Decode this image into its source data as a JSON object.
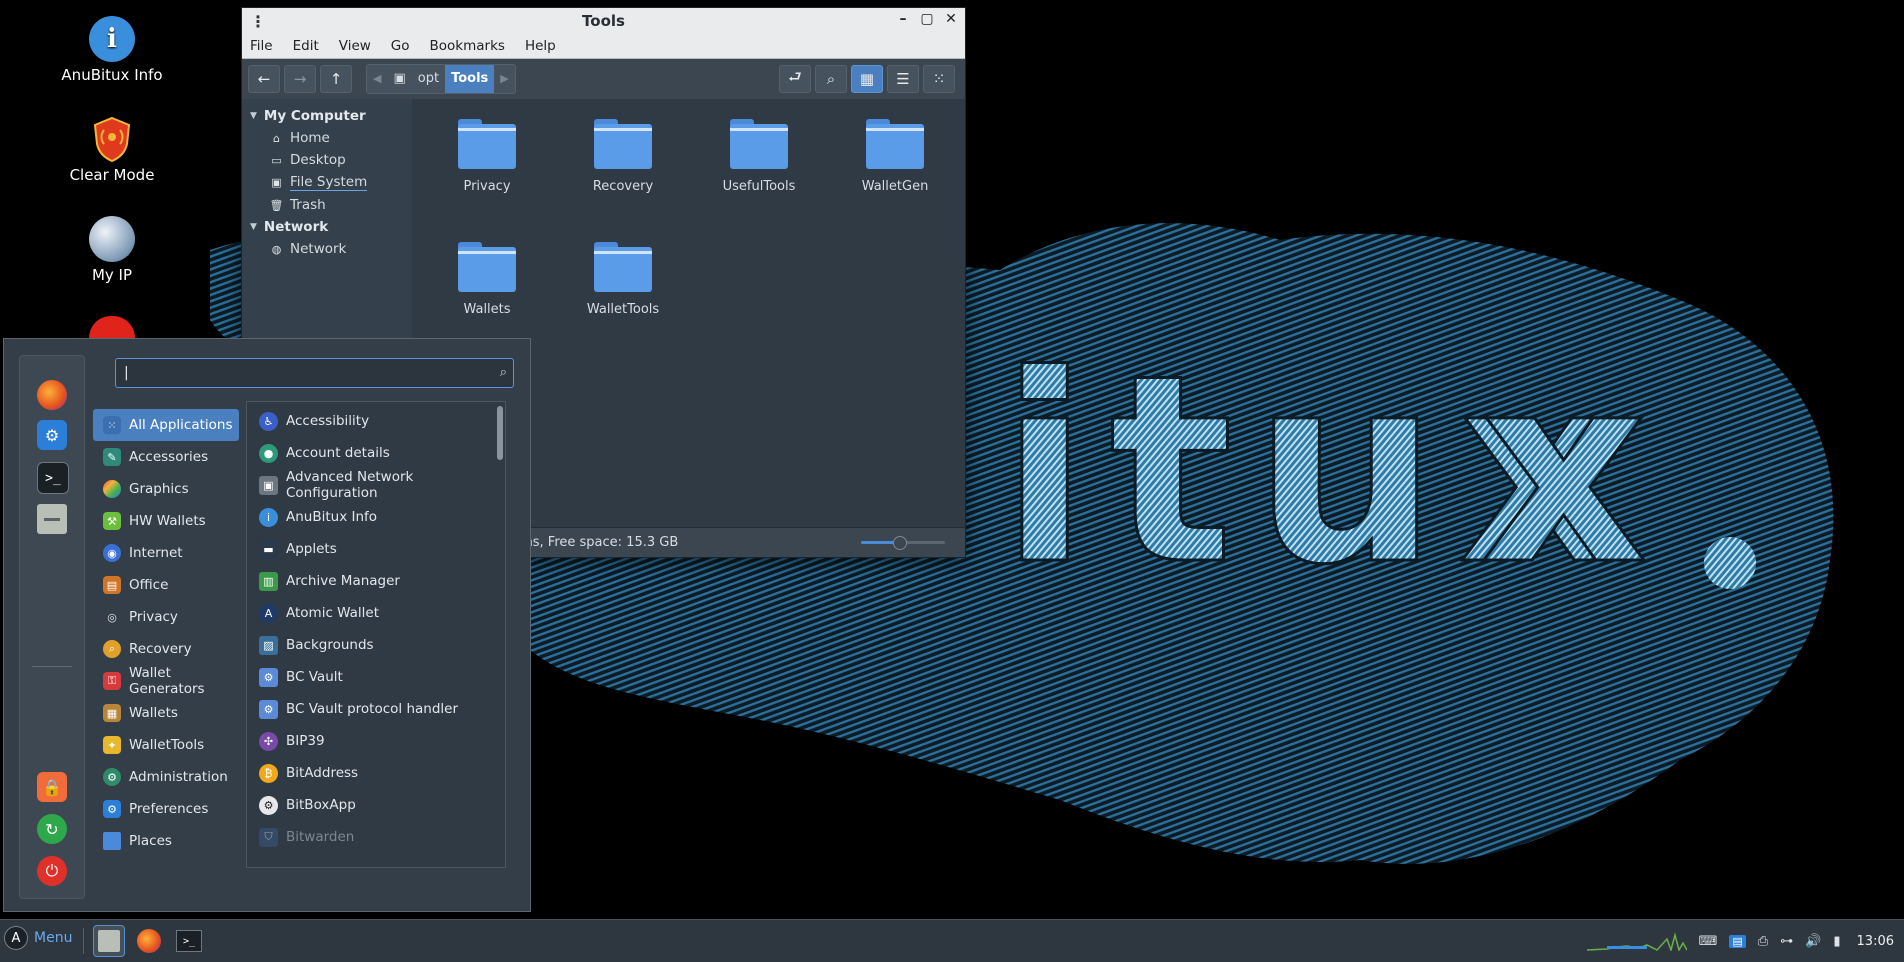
{
  "desktop": {
    "icons": [
      {
        "label": "AnuBitux Info",
        "icon": "info-icon"
      },
      {
        "label": "Clear Mode",
        "icon": "shield-icon"
      },
      {
        "label": "My IP",
        "icon": "globe-icon"
      }
    ],
    "wallpaper_text": "itux"
  },
  "file_manager": {
    "title": "Tools",
    "menu": [
      "File",
      "Edit",
      "View",
      "Go",
      "Bookmarks",
      "Help"
    ],
    "breadcrumb": {
      "parent": "opt",
      "current": "Tools"
    },
    "sidebar": {
      "sections": [
        {
          "label": "My Computer",
          "items": [
            "Home",
            "Desktop",
            "File System",
            "Trash"
          ]
        },
        {
          "label": "Network",
          "items": [
            "Network"
          ]
        }
      ]
    },
    "folders": [
      "Privacy",
      "Recovery",
      "UsefulTools",
      "WalletGen",
      "Wallets",
      "WalletTools"
    ],
    "status": "6 items, Free space: 15.3 GB",
    "zoom_level": 0.45
  },
  "app_menu": {
    "search": {
      "value": "",
      "placeholder": ""
    },
    "categories": [
      "All Applications",
      "Accessories",
      "Graphics",
      "HW Wallets",
      "Internet",
      "Office",
      "Privacy",
      "Recovery",
      "Wallet Generators",
      "Wallets",
      "WalletTools",
      "Administration",
      "Preferences",
      "Places"
    ],
    "selected_category": "All Applications",
    "apps": [
      "Accessibility",
      "Account details",
      "Advanced Network Configuration",
      "AnuBitux Info",
      "Applets",
      "Archive Manager",
      "Atomic Wallet",
      "Backgrounds",
      "BC Vault",
      "BC Vault protocol handler",
      "BIP39",
      "BitAddress",
      "BitBoxApp",
      "Bitwarden"
    ]
  },
  "taskbar": {
    "menu_label": "Menu",
    "clock": "13:06"
  },
  "colors": {
    "accent": "#4a7fc0",
    "folder": "#5a9ce8",
    "panel": "#2e3740"
  }
}
